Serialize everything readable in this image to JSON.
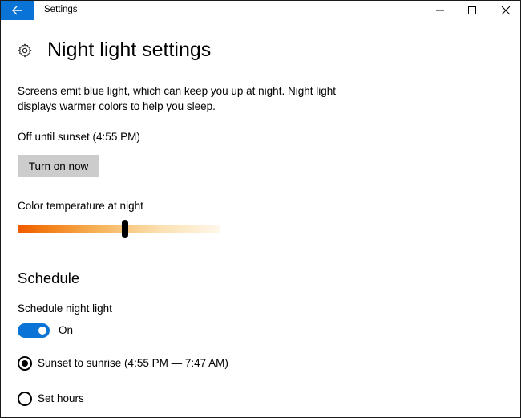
{
  "window": {
    "app_title": "Settings",
    "back_icon": "arrow-left-icon",
    "controls": [
      "minimize-icon",
      "maximize-icon",
      "close-icon"
    ],
    "accent": "#0a74d6"
  },
  "page": {
    "icon": "gear-icon",
    "title": "Night light settings",
    "description": "Screens emit blue light, which can keep you up at night. Night light displays warmer colors to help you sleep.",
    "status": "Off until sunset (4:55 PM)",
    "turn_on_button": "Turn on now"
  },
  "color_temperature": {
    "label": "Color temperature at night",
    "value_fraction": 0.53
  },
  "schedule": {
    "heading": "Schedule",
    "toggle_label": "Schedule night light",
    "toggle_state": "On",
    "toggle_on": true,
    "options": [
      {
        "label": "Sunset to sunrise (4:55 PM — 7:47 AM)",
        "selected": true
      },
      {
        "label": "Set hours",
        "selected": false
      }
    ]
  }
}
